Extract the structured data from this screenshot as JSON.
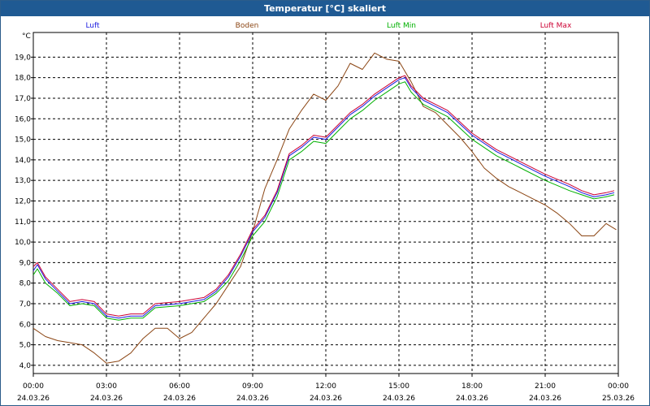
{
  "window": {
    "title": "Temperatur [°C] skaliert"
  },
  "legend": [
    {
      "label": "Luft",
      "color": "#1a1adf"
    },
    {
      "label": "Boden",
      "color": "#8b4513"
    },
    {
      "label": "Luft Min",
      "color": "#00b000"
    },
    {
      "label": "Luft Max",
      "color": "#cc0033"
    }
  ],
  "chart_data": {
    "type": "line",
    "title": "Temperatur [°C] skaliert",
    "ylabel": "°C",
    "xlabel": "",
    "ylim": [
      3.6,
      20.2
    ],
    "xlim": [
      "2026-03-24T00:00",
      "2026-03-25T00:00"
    ],
    "grid": true,
    "legend_position": "top",
    "yticks": [
      "4,0",
      "5,0",
      "6,0",
      "7,0",
      "8,0",
      "9,0",
      "10,0",
      "11,0",
      "12,0",
      "13,0",
      "14,0",
      "15,0",
      "16,0",
      "17,0",
      "18,0",
      "19,0"
    ],
    "xticks": [
      {
        "time": "00:00",
        "date": "24.03.26"
      },
      {
        "time": "03:00",
        "date": "24.03.26"
      },
      {
        "time": "06:00",
        "date": "24.03.26"
      },
      {
        "time": "09:00",
        "date": "24.03.26"
      },
      {
        "time": "12:00",
        "date": "24.03.26"
      },
      {
        "time": "15:00",
        "date": "24.03.26"
      },
      {
        "time": "18:00",
        "date": "24.03.26"
      },
      {
        "time": "21:00",
        "date": "24.03.26"
      },
      {
        "time": "00:00",
        "date": "25.03.26"
      }
    ],
    "series": [
      {
        "name": "Luft",
        "color": "#1a1adf",
        "x": [
          "00:00",
          "00:10",
          "00:30",
          "01:00",
          "01:30",
          "02:00",
          "02:30",
          "03:00",
          "03:30",
          "04:00",
          "04:30",
          "05:00",
          "06:00",
          "07:00",
          "07:30",
          "08:00",
          "08:30",
          "09:00",
          "09:30",
          "10:00",
          "10:30",
          "11:00",
          "11:30",
          "12:00",
          "12:30",
          "13:00",
          "13:30",
          "14:00",
          "14:30",
          "15:00",
          "15:15",
          "15:30",
          "16:00",
          "17:00",
          "18:00",
          "19:00",
          "20:00",
          "21:00",
          "22:00",
          "22:30",
          "23:00",
          "23:30",
          "23:50"
        ],
        "y": [
          8.6,
          8.9,
          8.2,
          7.6,
          7.0,
          7.1,
          7.0,
          6.4,
          6.3,
          6.4,
          6.4,
          6.9,
          7.0,
          7.2,
          7.6,
          8.3,
          9.3,
          10.5,
          11.2,
          12.4,
          14.2,
          14.6,
          15.1,
          15.0,
          15.6,
          16.2,
          16.6,
          17.1,
          17.5,
          17.9,
          18.0,
          17.5,
          16.9,
          16.3,
          15.2,
          14.4,
          13.8,
          13.2,
          12.7,
          12.4,
          12.2,
          12.3,
          12.4
        ]
      },
      {
        "name": "Boden",
        "color": "#8b4513",
        "x": [
          "00:00",
          "00:30",
          "01:00",
          "01:30",
          "02:00",
          "02:30",
          "03:00",
          "03:30",
          "04:00",
          "04:30",
          "05:00",
          "05:30",
          "06:00",
          "06:30",
          "07:00",
          "07:30",
          "08:00",
          "08:30",
          "09:00",
          "09:30",
          "10:00",
          "10:30",
          "11:00",
          "11:30",
          "12:00",
          "12:30",
          "13:00",
          "13:30",
          "14:00",
          "14:30",
          "15:00",
          "15:30",
          "16:00",
          "16:30",
          "17:00",
          "17:30",
          "18:00",
          "18:30",
          "19:00",
          "19:30",
          "20:00",
          "20:30",
          "21:00",
          "21:30",
          "22:00",
          "22:30",
          "23:00",
          "23:30",
          "23:55"
        ],
        "y": [
          5.8,
          5.4,
          5.2,
          5.1,
          5.0,
          4.6,
          4.1,
          4.2,
          4.6,
          5.3,
          5.8,
          5.8,
          5.3,
          5.6,
          6.3,
          7.0,
          7.9,
          8.8,
          10.5,
          12.6,
          14.0,
          15.5,
          16.4,
          17.2,
          16.9,
          17.6,
          18.7,
          18.4,
          19.2,
          18.9,
          18.8,
          17.8,
          16.6,
          16.3,
          15.7,
          15.1,
          14.4,
          13.6,
          13.1,
          12.7,
          12.4,
          12.1,
          11.8,
          11.4,
          10.9,
          10.3,
          10.3,
          10.9,
          10.6
        ]
      },
      {
        "name": "Luft Min",
        "color": "#00b000",
        "x": [
          "00:00",
          "00:10",
          "00:30",
          "01:00",
          "01:30",
          "02:00",
          "02:30",
          "03:00",
          "03:30",
          "04:00",
          "04:30",
          "05:00",
          "06:00",
          "07:00",
          "07:30",
          "08:00",
          "08:30",
          "09:00",
          "09:30",
          "10:00",
          "10:30",
          "11:00",
          "11:30",
          "12:00",
          "12:30",
          "13:00",
          "13:30",
          "14:00",
          "14:30",
          "15:00",
          "15:15",
          "15:30",
          "16:00",
          "17:00",
          "18:00",
          "19:00",
          "20:00",
          "21:00",
          "22:00",
          "22:30",
          "23:00",
          "23:30",
          "23:50"
        ],
        "y": [
          8.4,
          8.7,
          8.0,
          7.5,
          6.9,
          7.0,
          6.9,
          6.3,
          6.2,
          6.3,
          6.3,
          6.8,
          6.9,
          7.1,
          7.5,
          8.1,
          9.1,
          10.3,
          11.0,
          12.2,
          14.0,
          14.4,
          14.9,
          14.8,
          15.4,
          16.0,
          16.4,
          16.9,
          17.3,
          17.7,
          17.8,
          17.3,
          16.7,
          16.1,
          15.0,
          14.2,
          13.6,
          13.0,
          12.5,
          12.3,
          12.1,
          12.2,
          12.3
        ]
      },
      {
        "name": "Luft Max",
        "color": "#cc0033",
        "x": [
          "00:00",
          "00:10",
          "00:30",
          "01:00",
          "01:30",
          "02:00",
          "02:30",
          "03:00",
          "03:30",
          "04:00",
          "04:30",
          "05:00",
          "06:00",
          "07:00",
          "07:30",
          "08:00",
          "08:30",
          "09:00",
          "09:30",
          "10:00",
          "10:30",
          "11:00",
          "11:30",
          "12:00",
          "12:30",
          "13:00",
          "13:30",
          "14:00",
          "14:30",
          "15:00",
          "15:15",
          "15:30",
          "16:00",
          "17:00",
          "18:00",
          "19:00",
          "20:00",
          "21:00",
          "22:00",
          "22:30",
          "23:00",
          "23:30",
          "23:50"
        ],
        "y": [
          8.8,
          9.0,
          8.3,
          7.7,
          7.1,
          7.2,
          7.1,
          6.5,
          6.4,
          6.5,
          6.5,
          7.0,
          7.1,
          7.3,
          7.7,
          8.4,
          9.4,
          10.6,
          11.3,
          12.5,
          14.3,
          14.7,
          15.2,
          15.1,
          15.7,
          16.3,
          16.7,
          17.2,
          17.6,
          18.0,
          18.1,
          17.6,
          17.0,
          16.4,
          15.3,
          14.5,
          13.9,
          13.3,
          12.8,
          12.5,
          12.3,
          12.4,
          12.5
        ]
      }
    ]
  }
}
